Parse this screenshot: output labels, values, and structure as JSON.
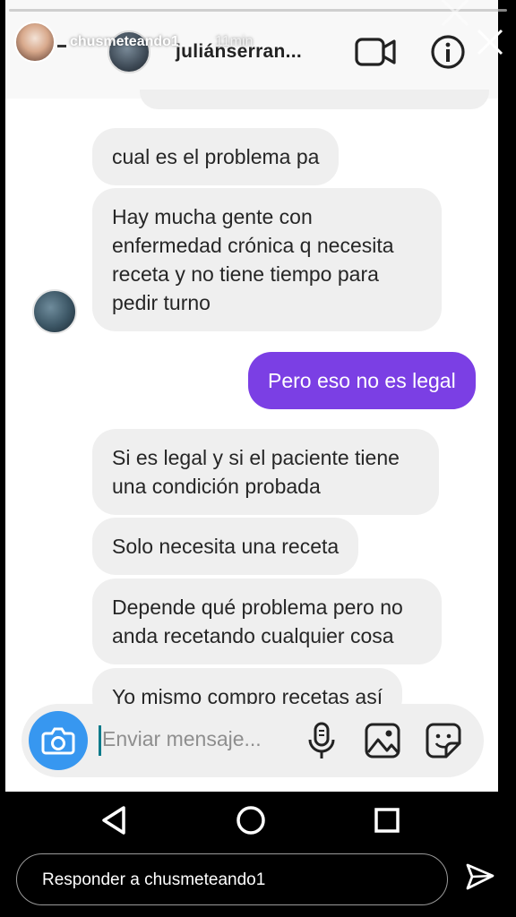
{
  "story": {
    "username": "chusmeteando1",
    "time": "11min",
    "reply_placeholder": "Responder a chusmeteando1",
    "icons": {
      "close": "close-icon",
      "send": "send-icon"
    }
  },
  "dm": {
    "contact_name": "juliánserran...",
    "icons": {
      "video": "video-call-icon",
      "info": "info-icon"
    }
  },
  "messages": [
    {
      "dir": "in",
      "text": "cual es el problema pa"
    },
    {
      "dir": "in",
      "lines": [
        "Hay mucha gente con",
        "enfermedad crónica q necesita",
        "receta y no tiene tiempo para",
        "pedir turno"
      ]
    },
    {
      "dir": "out",
      "text": "Pero eso no es legal"
    },
    {
      "dir": "in",
      "lines": [
        "Si es legal y si el paciente tiene",
        "una condición probada"
      ]
    },
    {
      "dir": "in",
      "text": "Solo necesita una receta"
    },
    {
      "dir": "in",
      "lines": [
        "Depende qué problema pero no",
        "anda recetando cualquier cosa"
      ]
    },
    {
      "dir": "in",
      "text": "Yo mismo compro recetas así"
    }
  ],
  "composer": {
    "placeholder": "Enviar mensaje...",
    "icons": [
      "camera-icon",
      "microphone-icon",
      "gallery-icon",
      "sticker-icon"
    ]
  },
  "colors": {
    "outgoing_bubble": "#7b3fe4",
    "incoming_bubble": "#efefef",
    "camera_button": "#3797f0"
  }
}
